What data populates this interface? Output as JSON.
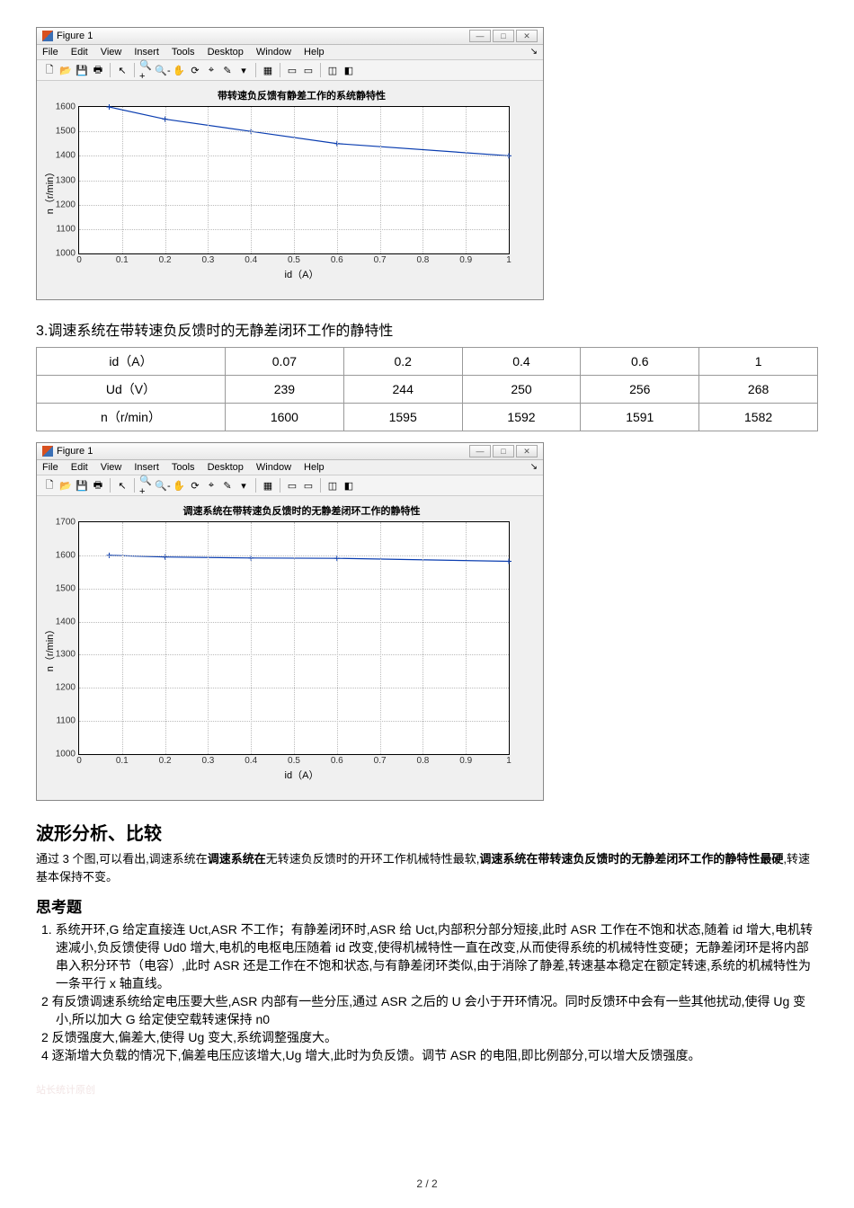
{
  "figure1": {
    "winTitle": "Figure 1",
    "menus": [
      "File",
      "Edit",
      "View",
      "Insert",
      "Tools",
      "Desktop",
      "Window",
      "Help"
    ],
    "title": "带转速负反馈有静差工作的系统静特性",
    "ylabel": "n（r/min）",
    "xlabel": "id（A）",
    "ylim": [
      1000,
      1600
    ],
    "yticks": [
      1000,
      1100,
      1200,
      1300,
      1400,
      1500,
      1600
    ],
    "xlim": [
      0,
      1
    ],
    "xticks": [
      0,
      0.1,
      0.2,
      0.3,
      0.4,
      0.5,
      0.6,
      0.7,
      0.8,
      0.9,
      1
    ],
    "chart_data": {
      "type": "line",
      "x": [
        0.07,
        0.2,
        0.4,
        0.6,
        1
      ],
      "y": [
        1600,
        1550,
        1500,
        1450,
        1400
      ]
    }
  },
  "section3_heading": "3.调速系统在带转速负反馈时的无静差闭环工作的静特性",
  "table": {
    "rows": [
      {
        "label": "id（A）",
        "vals": [
          "0.07",
          "0.2",
          "0.4",
          "0.6",
          "1"
        ]
      },
      {
        "label": "Ud（V）",
        "vals": [
          "239",
          "244",
          "250",
          "256",
          "268"
        ]
      },
      {
        "label": "n（r/min）",
        "vals": [
          "1600",
          "1595",
          "1592",
          "1591",
          "1582"
        ]
      }
    ]
  },
  "figure2": {
    "winTitle": "Figure 1",
    "menus": [
      "File",
      "Edit",
      "View",
      "Insert",
      "Tools",
      "Desktop",
      "Window",
      "Help"
    ],
    "title": "调速系统在带转速负反馈时的无静差闭环工作的静特性",
    "ylabel": "n（r/min）",
    "xlabel": "id（A）",
    "ylim": [
      1000,
      1700
    ],
    "yticks": [
      1000,
      1100,
      1200,
      1300,
      1400,
      1500,
      1600,
      1700
    ],
    "xlim": [
      0,
      1
    ],
    "xticks": [
      0,
      0.1,
      0.2,
      0.3,
      0.4,
      0.5,
      0.6,
      0.7,
      0.8,
      0.9,
      1
    ],
    "chart_data": {
      "type": "line",
      "x": [
        0.07,
        0.2,
        0.4,
        0.6,
        1
      ],
      "y": [
        1600,
        1595,
        1592,
        1591,
        1582
      ]
    }
  },
  "analysis_heading": "波形分析、比较",
  "analysis_para_pre": "通过 3 个图,可以看出,调速系统在",
  "analysis_para_bold1": "调速系统在",
  "analysis_para_mid": "无转速负反馈时的开环工作机械特性最软,",
  "analysis_para_bold2": "调速系统在带转速负反馈时的无静差闭环工作的静特性最硬",
  "analysis_para_end": ",转速基本保持不变。",
  "questions_heading": "思考题",
  "questions": [
    "系统开环,G 给定直接连 Uct,ASR 不工作；有静差闭环时,ASR 给 Uct,内部积分部分短接,此时 ASR 工作在不饱和状态,随着 id 增大,电机转速减小,负反馈使得 Ud0 增大,电机的电枢电压随着 id 改变,使得机械特性一直在改变,从而使得系统的机械特性变硬；无静差闭环是将内部串入积分环节（电容）,此时 ASR 还是工作在不饱和状态,与有静差闭环类似,由于消除了静差,转速基本稳定在额定转速,系统的机械特性为一条平行 x 轴直线。",
    "有反馈调速系统给定电压要大些,ASR 内部有一些分压,通过 ASR 之后的 U 会小于开环情况。同时反馈环中会有一些其他扰动,使得 Ug 变小,所以加大 G 给定使空载转速保持 n0",
    "反馈强度大,偏差大,使得 Ug 变大,系统调整强度大。",
    "逐渐增大负载的情况下,偏差电压应该增大,Ug 增大,此时为负反馈。调节 ASR 的电阻,即比例部分,可以增大反馈强度。"
  ],
  "q_numbers": [
    "1.",
    "2",
    "2",
    "4"
  ],
  "watermark": "站长统计原创",
  "page": "2 / 2",
  "chart_data": [
    {
      "type": "line",
      "title": "带转速负反馈有静差工作的系统静特性",
      "xlabel": "id（A）",
      "ylabel": "n（r/min）",
      "xlim": [
        0,
        1
      ],
      "ylim": [
        1000,
        1600
      ],
      "x": [
        0.07,
        0.2,
        0.4,
        0.6,
        1
      ],
      "y": [
        1600,
        1550,
        1500,
        1450,
        1400
      ]
    },
    {
      "type": "line",
      "title": "调速系统在带转速负反馈时的无静差闭环工作的静特性",
      "xlabel": "id（A）",
      "ylabel": "n（r/min）",
      "xlim": [
        0,
        1
      ],
      "ylim": [
        1000,
        1700
      ],
      "x": [
        0.07,
        0.2,
        0.4,
        0.6,
        1
      ],
      "y": [
        1600,
        1595,
        1592,
        1591,
        1582
      ]
    }
  ]
}
